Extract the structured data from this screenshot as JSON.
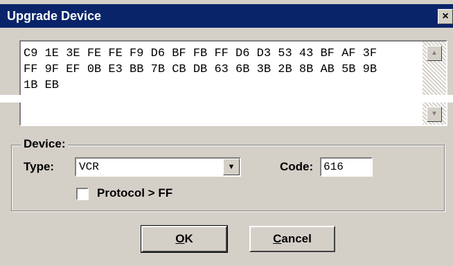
{
  "window": {
    "title": "Upgrade Device",
    "close_glyph": "×"
  },
  "hex": {
    "text": "C9 1E 3E FE FE F9 D6 BF FB FF D6 D3 53 43 BF AF 3F FF 9F EF 0B E3 BB 7B CB DB 63 6B 3B 2B 8B AB 5B 9B 1B EB"
  },
  "scroll": {
    "up_glyph": "▲",
    "down_glyph": "▼"
  },
  "device": {
    "group_label": "Device:",
    "type_label": "Type:",
    "type_value": "VCR",
    "combo_glyph": "▼",
    "code_label": "Code:",
    "code_value": "616",
    "protocol_label": "Protocol > FF"
  },
  "buttons": {
    "ok_mnemonic": "O",
    "ok_rest": "K",
    "cancel_mnemonic": "C",
    "cancel_rest": "ancel"
  }
}
